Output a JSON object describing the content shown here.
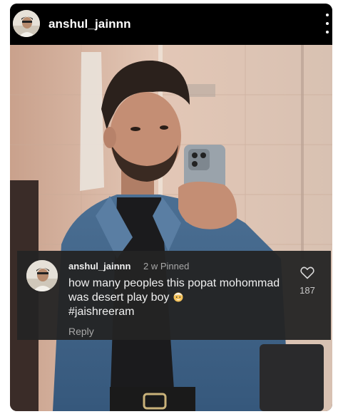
{
  "post": {
    "username": "anshul_jainnn",
    "more_icon": "more-vertical-icon"
  },
  "comment": {
    "username": "anshul_jainnn",
    "meta": "2 w Pinned",
    "text": "how many peoples this popat mohommad was desert play boy",
    "emoji": "old-man-emoji",
    "hashtag": "#jaishreeram",
    "like_count": "187",
    "reply_label": "Reply",
    "like_icon": "heart-icon"
  },
  "colors": {
    "background": "#000000",
    "overlay": "#242424",
    "text": "#f0f0f0",
    "muted": "#a8a8a8"
  }
}
